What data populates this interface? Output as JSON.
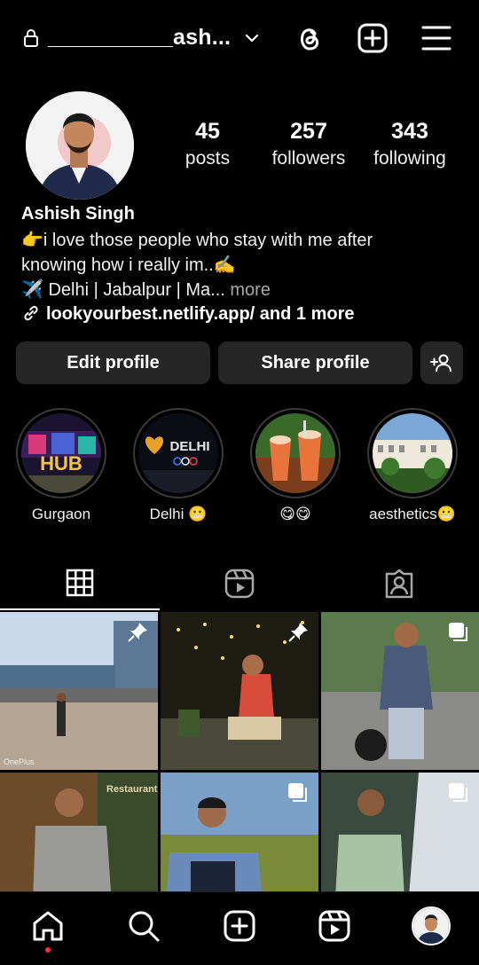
{
  "header": {
    "username": "__________ash...",
    "icons": [
      "lock-icon",
      "chevron-down-icon",
      "threads-icon",
      "new-post-icon",
      "menu-icon"
    ]
  },
  "profile": {
    "stats": {
      "posts": {
        "value": "45",
        "label": "posts"
      },
      "followers": {
        "value": "257",
        "label": "followers"
      },
      "following": {
        "value": "343",
        "label": "following"
      }
    },
    "name": "Ashish Singh",
    "bio": [
      "👉i love those people who stay with me after",
      "knowing how i really im..✍️",
      "✈️ Delhi | Jabalpur | Ma... "
    ],
    "more_label": "more",
    "link": "lookyourbest.netlify.app/ and 1 more"
  },
  "actions": {
    "edit_label": "Edit profile",
    "share_label": "Share profile"
  },
  "highlights": [
    {
      "caption": "Gurgaon"
    },
    {
      "caption": "Delhi 😬"
    },
    {
      "caption": "😋😋"
    },
    {
      "caption": "aesthetics😬"
    }
  ],
  "highlight_texts": {
    "delhi_sign": "DELHI",
    "hub_sign": "HUB"
  },
  "tabs": [
    "grid-icon",
    "reels-icon",
    "tagged-icon"
  ],
  "grid_overlay_texts": {
    "watermark": "OnePlus",
    "restaurant": "Restaurant"
  },
  "colors": {
    "background": "#000000",
    "button": "#262626",
    "muted": "#a8a8a8",
    "notification": "#ff3040"
  }
}
